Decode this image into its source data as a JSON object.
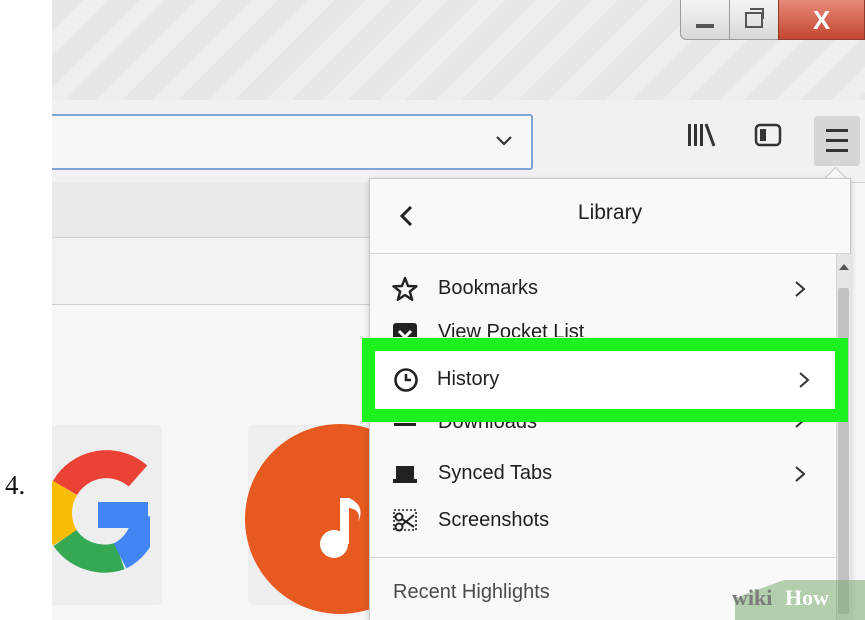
{
  "step": {
    "number": "4."
  },
  "window": {
    "close_glyph": "X"
  },
  "toolbar": {
    "icons": [
      "library-icon",
      "sidebar-icon",
      "hamburger-menu-icon",
      "chevron-down-icon"
    ]
  },
  "panel": {
    "title": "Library",
    "items": [
      {
        "label": "Bookmarks",
        "icon": "star-icon",
        "has_submenu": true
      },
      {
        "label": "View Pocket List",
        "icon": "pocket-icon",
        "has_submenu": false
      },
      {
        "label": "History",
        "icon": "clock-icon",
        "has_submenu": true,
        "highlighted": true
      },
      {
        "label": "Downloads",
        "icon": "download-icon",
        "has_submenu": true
      },
      {
        "label": "Synced Tabs",
        "icon": "laptop-icon",
        "has_submenu": true
      },
      {
        "label": "Screenshots",
        "icon": "scissors-icon",
        "has_submenu": false
      }
    ],
    "recent_label": "Recent Highlights"
  },
  "shortcuts": [
    {
      "name": "Google",
      "icon": "google-logo"
    },
    {
      "name": "Music",
      "icon": "music-note-icon"
    }
  ],
  "watermark": {
    "wiki": "wiki",
    "how": "How"
  },
  "colors": {
    "highlight": "#1ef21e",
    "music_tile": "#e65a21",
    "url_focus": "#7ea4d6"
  }
}
